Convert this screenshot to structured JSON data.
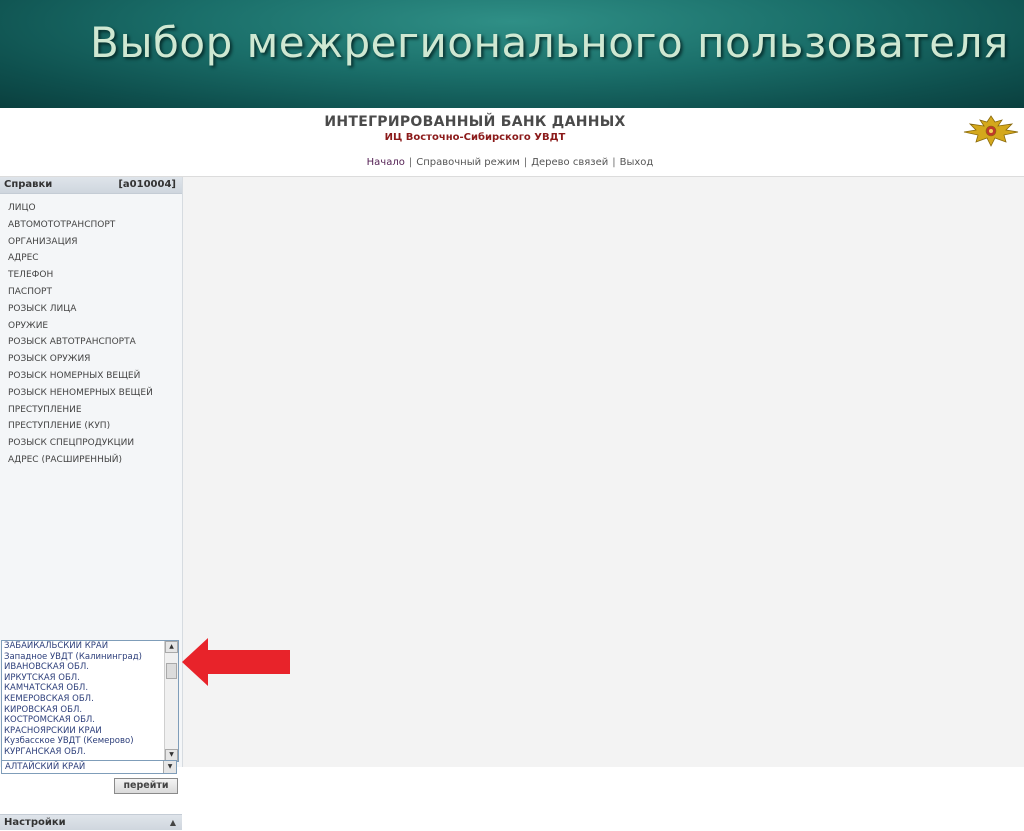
{
  "slide": {
    "title": "Выбор межрегионального пользователя"
  },
  "app": {
    "title": "ИНТЕГРИРОВАННЫЙ БАНК ДАННЫХ",
    "subtitle": "ИЦ Восточно-Сибирского УВДТ",
    "nav": [
      {
        "label": "Начало"
      },
      {
        "label": "Справочный режим"
      },
      {
        "label": "Дерево связей"
      },
      {
        "label": "Выход"
      }
    ],
    "nav_separator": "|"
  },
  "sidebar": {
    "header_label": "Справки",
    "header_code": "[a010004]",
    "menu": [
      "ЛИЦО",
      "АВТОМОТОТРАНСПОРТ",
      "ОРГАНИЗАЦИЯ",
      "АДРЕС",
      "ТЕЛЕФОН",
      "ПАСПОРТ",
      "РОЗЫСК ЛИЦА",
      "ОРУЖИЕ",
      "РОЗЫСК АВТОТРАНСПОРТА",
      "РОЗЫСК ОРУЖИЯ",
      "РОЗЫСК НОМЕРНЫХ ВЕЩЕЙ",
      "РОЗЫСК НЕНОМЕРНЫХ ВЕЩЕЙ",
      "ПРЕСТУПЛЕНИЕ",
      "ПРЕСТУПЛЕНИЕ (КУП)",
      "РОЗЫСК СПЕЦПРОДУКЦИИ",
      "АДРЕС (РАСШИРЕННЫЙ)"
    ],
    "region_list": [
      "ЗАБАЙКАЛЬСКИЙ КРАЙ",
      "Западное УВДТ (Калининград)",
      "ИВАНОВСКАЯ ОБЛ.",
      "ИРКУТСКАЯ ОБЛ.",
      "КАМЧАТСКАЯ ОБЛ.",
      "КЕМЕРОВСКАЯ ОБЛ.",
      "КИРОВСКАЯ ОБЛ.",
      "КОСТРОМСКАЯ ОБЛ.",
      "КРАСНОЯРСКИЙ КРАЙ",
      "Кузбасское УВДТ (Кемерово)",
      "КУРГАНСКАЯ ОБЛ."
    ],
    "selected_region": "АЛТАЙСКИЙ КРАЙ",
    "go_button": "перейти",
    "settings_label": "Настройки"
  },
  "colors": {
    "banner": "#1a6e69",
    "arrow": "#e8232a",
    "subtitle": "#8b1a1a"
  }
}
